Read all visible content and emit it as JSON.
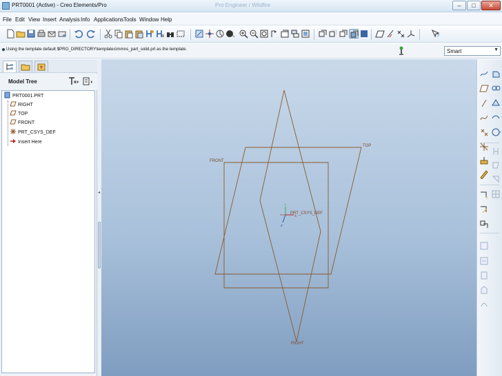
{
  "window": {
    "title": "PRT0001 (Active) - Creo Elements/Pro",
    "ghost_title": "Pro Engineer / Wildfire",
    "minimize_label": "–",
    "maximize_label": "□",
    "close_label": "✕"
  },
  "menubar": {
    "items": [
      "File",
      "Edit",
      "View",
      "Insert",
      "Analysis",
      "Info",
      "Applications",
      "Tools",
      "Window",
      "Help"
    ]
  },
  "toolbar": {
    "icons": [
      "new-icon",
      "open-icon",
      "save-icon",
      "print-icon",
      "email-icon",
      "email-link-icon",
      "undo-icon",
      "redo-icon",
      "cut-icon",
      "copy-icon",
      "paste-icon",
      "paste-special-icon",
      "regenerate-icon",
      "regen-manager-icon",
      "find-icon",
      "select-box-icon",
      "repaint-icon",
      "spin-center-icon",
      "orient-mode-icon",
      "appearance-icon",
      "zoom-in-icon",
      "zoom-out-icon",
      "refit-icon",
      "reorient-icon",
      "saved-views-icon",
      "layers-icon",
      "view-manager-icon",
      "wireframe-icon",
      "hidden-line-icon",
      "no-hidden-icon",
      "shading-icon",
      "enhanced-realism-icon",
      "datum-planes-icon",
      "datum-axes-icon",
      "datum-points-icon",
      "coord-sys-icon",
      "context-help-icon"
    ]
  },
  "message": {
    "text": "Using the template default $PRO_DIRECTORY\\templates\\mmns_part_solid.prt as the template."
  },
  "filter": {
    "selected": "Smart"
  },
  "model_tree": {
    "title": "Model Tree",
    "items": [
      {
        "label": "PRT0001.PRT",
        "icon": "part-icon"
      },
      {
        "label": "RIGHT",
        "icon": "datum-plane-icon"
      },
      {
        "label": "TOP",
        "icon": "datum-plane-icon"
      },
      {
        "label": "FRONT",
        "icon": "datum-plane-icon"
      },
      {
        "label": "PRT_CSYS_DEF",
        "icon": "csys-icon"
      },
      {
        "label": "Insert Here",
        "icon": "insert-arrow-icon"
      }
    ]
  },
  "graphics": {
    "plane_labels": {
      "top": "TOP",
      "front": "FRONT",
      "right": "RIGHT",
      "csys": "PRT_CSYS_DEF"
    },
    "csys_axis_labels": {
      "x": "X",
      "y": "Y",
      "z": "Z"
    },
    "datum_color": "#8b5a2b"
  },
  "right_toolbar": {
    "icons": [
      "sketch-icon",
      "plane-icon",
      "axis-icon",
      "curve-icon",
      "point-icon",
      "csys-icon",
      "analysis-icon",
      "extrude-icon",
      "revolve-icon",
      "sweep-icon",
      "blend-icon",
      "hole-icon",
      "shell-icon",
      "rib-icon",
      "draft-icon",
      "round-icon",
      "chamfer-icon",
      "pattern-icon",
      "mirror-icon",
      "merge-icon",
      "trim-icon",
      "offset-icon",
      "thicken-icon",
      "solidify-icon"
    ]
  }
}
